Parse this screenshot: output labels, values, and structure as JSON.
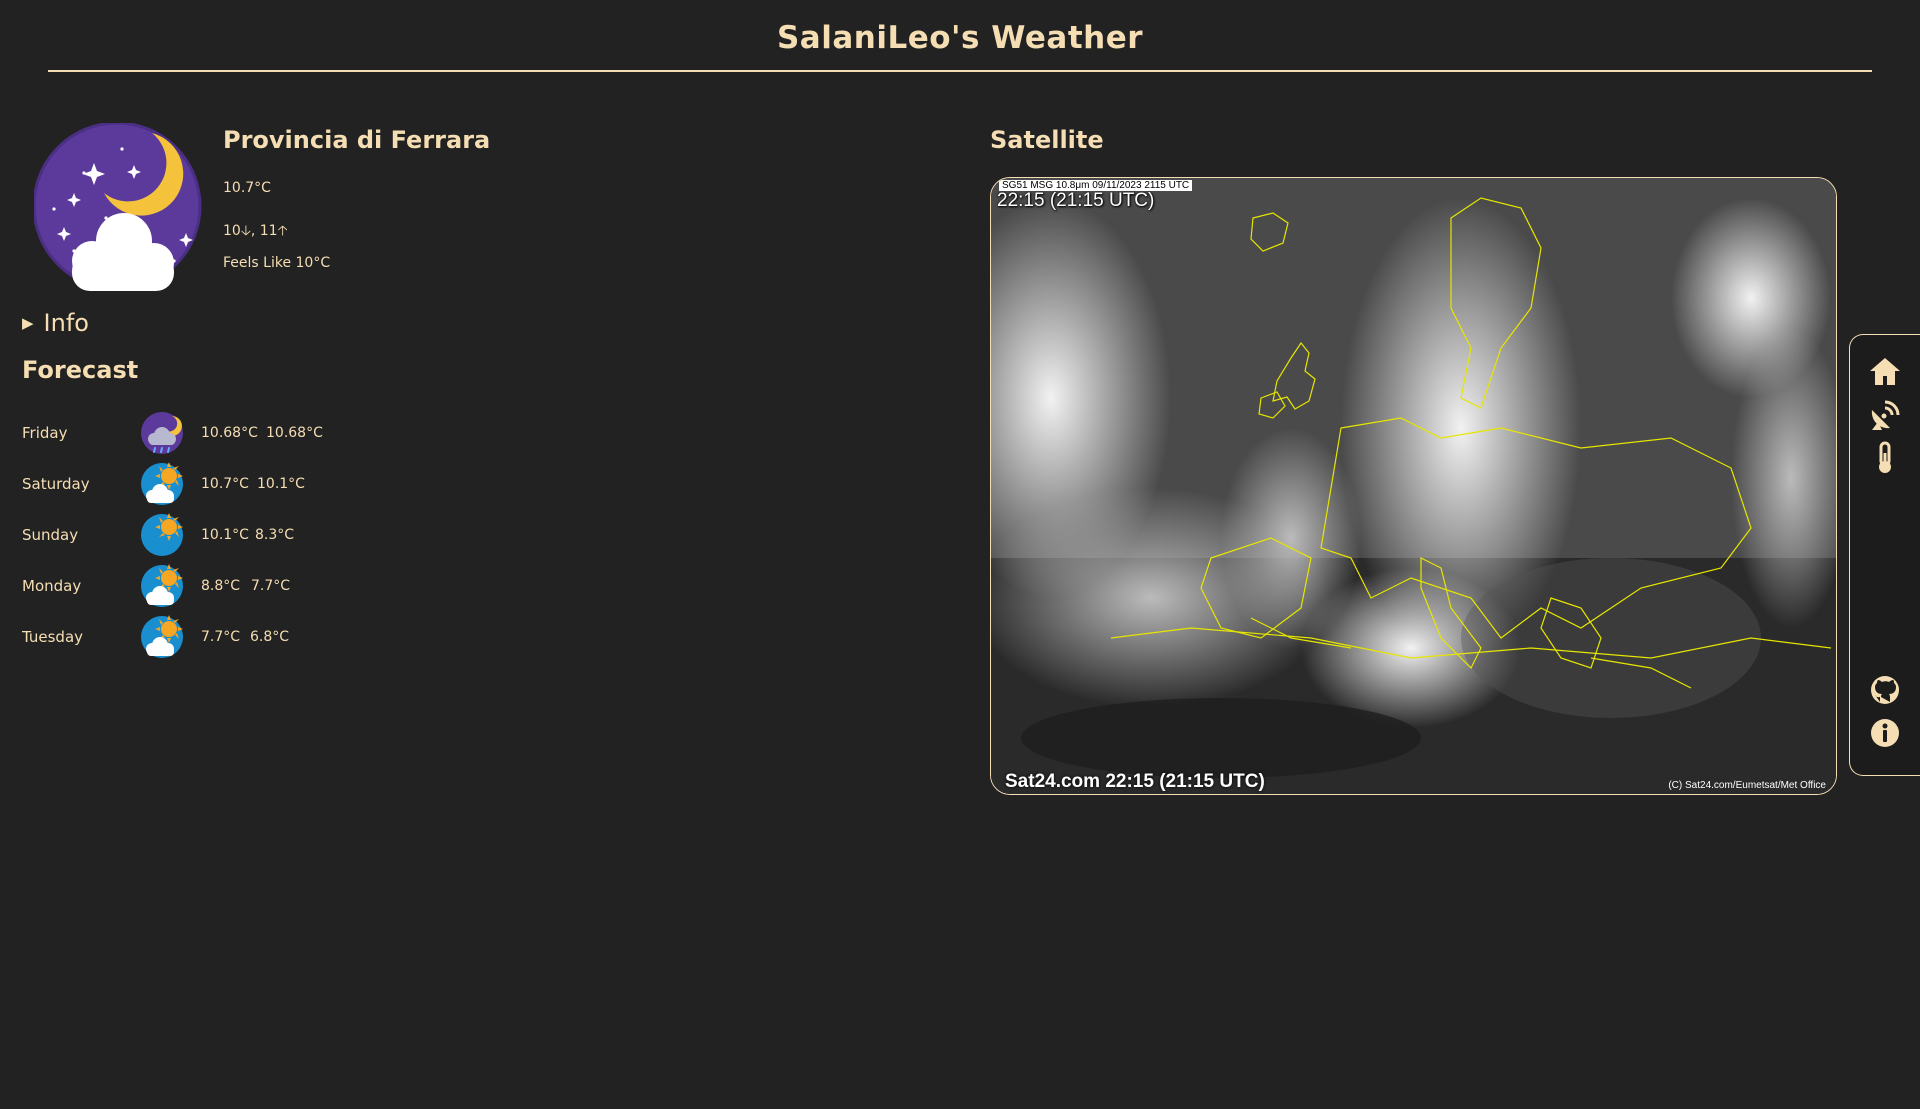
{
  "header": {
    "title": "SalaniLeo's Weather"
  },
  "current": {
    "location": "Provincia di Ferrara",
    "temperature": "10.7°C",
    "minmax": "10🡣, 11🡡",
    "feels_like": "Feels Like 10°C",
    "icon": "night-partly-cloudy-icon"
  },
  "info": {
    "label": "Info"
  },
  "forecast": {
    "title": "Forecast",
    "days": [
      {
        "day": "Friday",
        "max": "10.68°C",
        "min": "10.68°C",
        "icon": "night-rain-icon"
      },
      {
        "day": "Saturday",
        "max": "10.7°C",
        "min": "10.1°C",
        "icon": "sun-cloud-icon"
      },
      {
        "day": "Sunday",
        "max": "10.1°C",
        "min": "8.3°C",
        "icon": "sun-icon"
      },
      {
        "day": "Monday",
        "max": "8.8°C",
        "min": "7.7°C",
        "icon": "sun-cloud-icon"
      },
      {
        "day": "Tuesday",
        "max": "7.7°C",
        "min": "6.8°C",
        "icon": "sun-cloud-icon"
      }
    ]
  },
  "satellite": {
    "title": "Satellite",
    "top_bar": "SG51 MSG 10.8μm  09/11/2023  2115 UTC",
    "time_top": "22:15 (21:15 UTC)",
    "caption": "Sat24.com 22:15 (21:15 UTC)",
    "credit": "(C) Sat24.com/Eumetsat/Met Office"
  },
  "nav": {
    "items": [
      "home-icon",
      "satellite-dish-icon",
      "thermometer-icon",
      "github-icon",
      "info-circle-icon"
    ]
  },
  "colors": {
    "background": "#222222",
    "accent": "#f5deb3"
  }
}
